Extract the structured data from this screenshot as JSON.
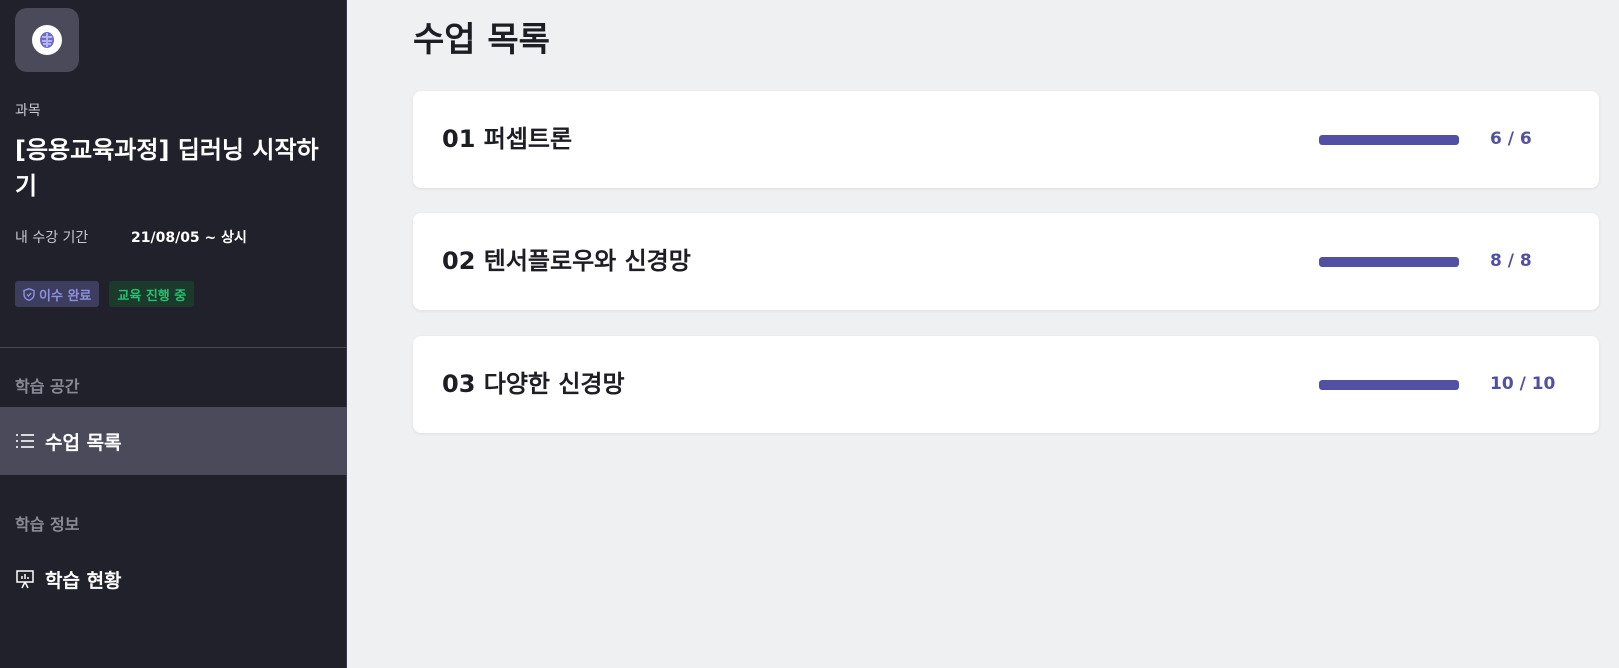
{
  "sidebar": {
    "logo_icon": "brain-icon",
    "course_label": "과목",
    "course_title": "[응용교육과정] 딥러닝 시작하기",
    "period_label": "내 수강 기간",
    "period_value": "21/08/05 ~ 상시",
    "badges": [
      {
        "label": "이수 완료",
        "icon": "shield-icon",
        "color": "#8f8fe0"
      },
      {
        "label": "교육 진행 중",
        "color": "#25c16f"
      }
    ],
    "sections": [
      {
        "label": "학습 공간",
        "items": [
          {
            "label": "수업 목록",
            "icon": "list-icon",
            "active": true
          }
        ]
      },
      {
        "label": "학습 정보",
        "items": [
          {
            "label": "학습 현황",
            "icon": "presentation-icon",
            "active": false
          }
        ]
      }
    ]
  },
  "main": {
    "title": "수업 목록",
    "lessons": [
      {
        "title": "01 퍼셉트론",
        "progress_text": "6 / 6",
        "progress": 1.0
      },
      {
        "title": "02 텐서플로우와 신경망",
        "progress_text": "8 / 8",
        "progress": 1.0
      },
      {
        "title": "03 다양한 신경망",
        "progress_text": "10 / 10",
        "progress": 1.0
      }
    ]
  },
  "colors": {
    "sidebar_bg": "#21212b",
    "accent": "#5250a3",
    "active_item_bg": "#4a4a5a"
  }
}
